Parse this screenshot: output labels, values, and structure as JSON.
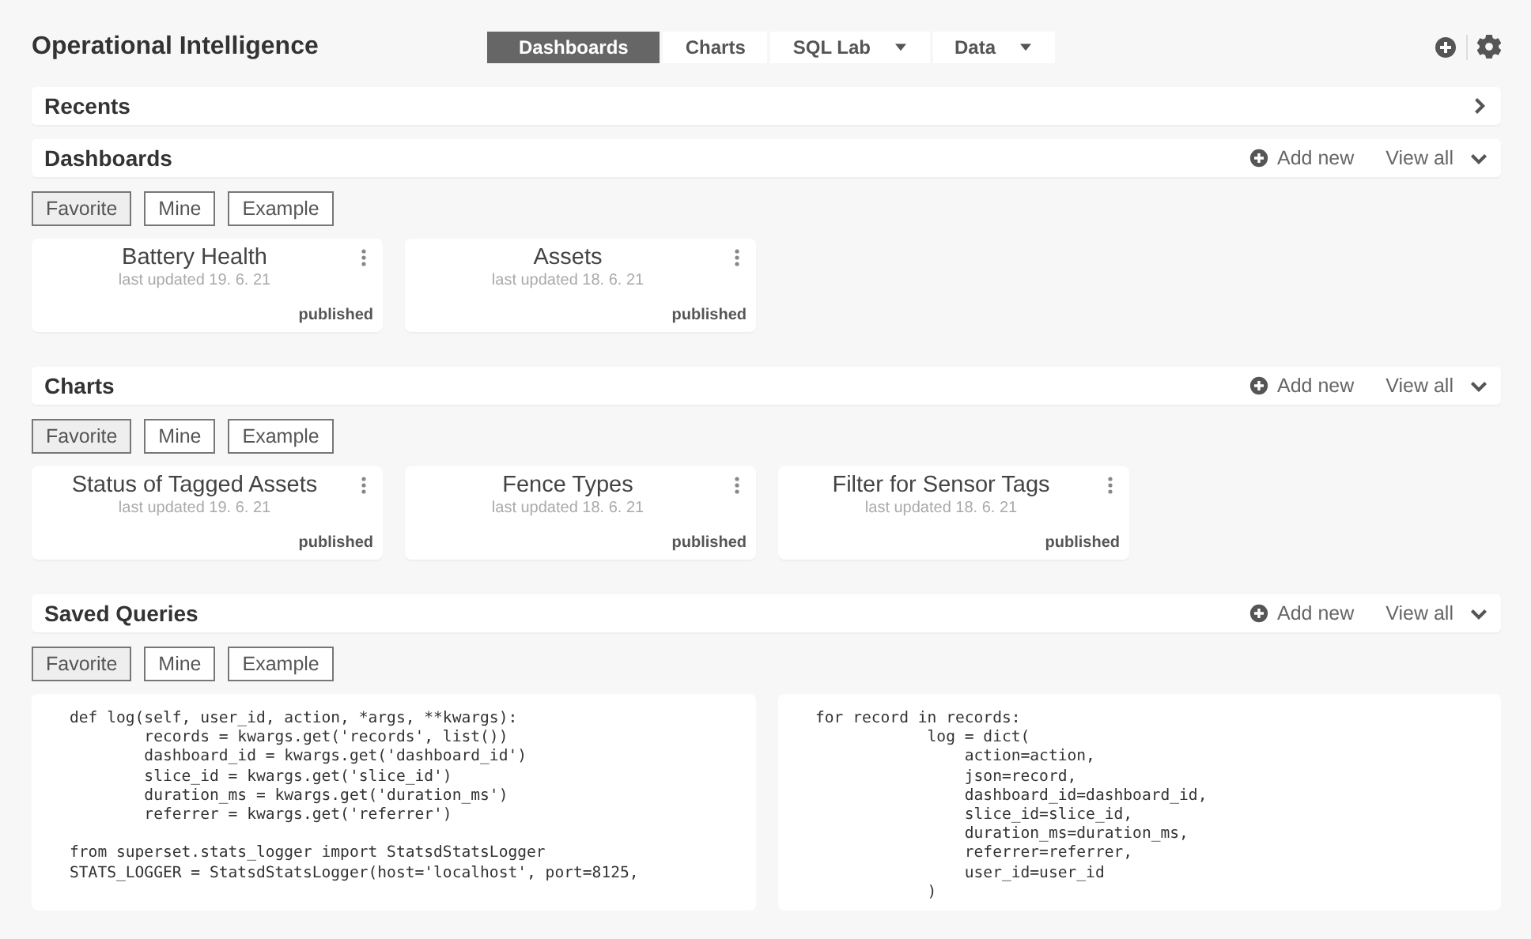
{
  "header": {
    "title": "Operational Intelligence",
    "nav": [
      {
        "label": "Dashboards",
        "selected": true,
        "dropdown": false
      },
      {
        "label": "Charts",
        "selected": false,
        "dropdown": false
      },
      {
        "label": "SQL Lab",
        "selected": false,
        "dropdown": true
      },
      {
        "label": "Data",
        "selected": false,
        "dropdown": true
      }
    ]
  },
  "sections": [
    {
      "kind": "collapsed",
      "title": "Recents",
      "expanded": false
    },
    {
      "kind": "cards",
      "title": "Dashboards",
      "expanded": true,
      "add_new": "Add new",
      "view_all": "View all",
      "filters": [
        {
          "label": "Favorite",
          "selected": true
        },
        {
          "label": "Mine",
          "selected": false
        },
        {
          "label": "Example",
          "selected": false
        }
      ],
      "cards": [
        {
          "title": "Battery Health",
          "updated": "last updated 19. 6. 21",
          "status": "published"
        },
        {
          "title": "Assets",
          "updated": "last updated 18. 6. 21",
          "status": "published"
        }
      ]
    },
    {
      "kind": "cards",
      "title": "Charts",
      "expanded": true,
      "add_new": "Add new",
      "view_all": "View all",
      "filters": [
        {
          "label": "Favorite",
          "selected": true
        },
        {
          "label": "Mine",
          "selected": false
        },
        {
          "label": "Example",
          "selected": false
        }
      ],
      "cards": [
        {
          "title": "Status of Tagged Assets",
          "updated": "last updated 19. 6. 21",
          "status": "published"
        },
        {
          "title": "Fence Types",
          "updated": "last updated 18. 6. 21",
          "status": "published"
        },
        {
          "title": "Filter for Sensor Tags",
          "updated": "last updated 18. 6. 21",
          "status": "published"
        }
      ]
    },
    {
      "kind": "queries",
      "title": "Saved Queries",
      "expanded": true,
      "add_new": "Add new",
      "view_all": "View all",
      "filters": [
        {
          "label": "Favorite",
          "selected": true
        },
        {
          "label": "Mine",
          "selected": false
        },
        {
          "label": "Example",
          "selected": false
        }
      ],
      "queries": [
        {
          "code": "def log(self, user_id, action, *args, **kwargs):\n        records = kwargs.get('records', list())\n        dashboard_id = kwargs.get('dashboard_id')\n        slice_id = kwargs.get('slice_id')\n        duration_ms = kwargs.get('duration_ms')\n        referrer = kwargs.get('referrer')\n\nfrom superset.stats_logger import StatsdStatsLogger\nSTATS_LOGGER = StatsdStatsLogger(host='localhost', port=8125,"
        },
        {
          "code": "for record in records:\n            log = dict(\n                action=action,\n                json=record,\n                dashboard_id=dashboard_id,\n                slice_id=slice_id,\n                duration_ms=duration_ms,\n                referrer=referrer,\n                user_id=user_id\n            )"
        }
      ]
    }
  ]
}
